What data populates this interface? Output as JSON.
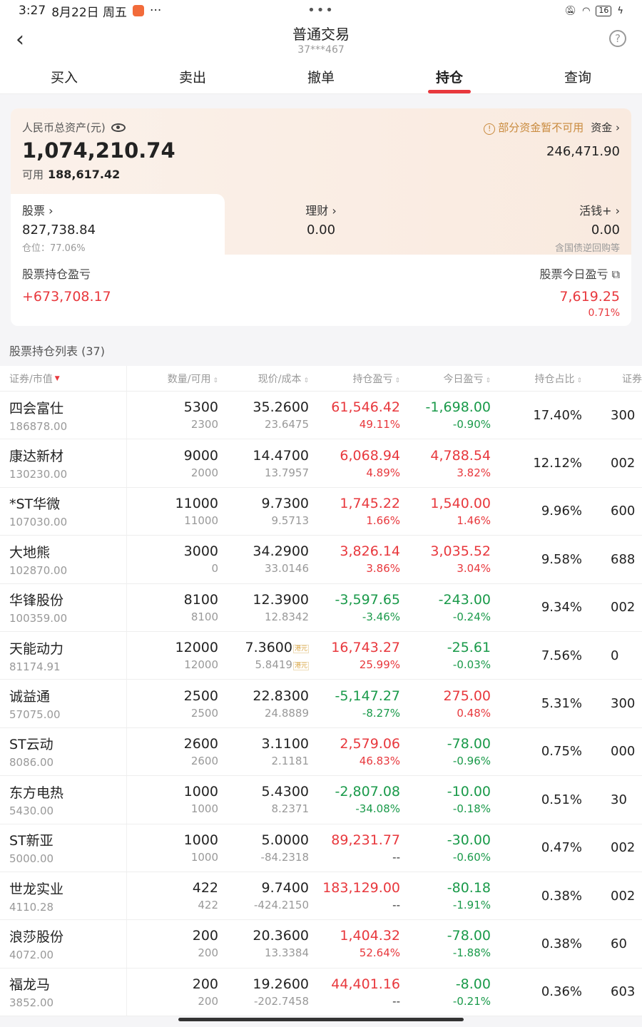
{
  "status": {
    "time": "3:27",
    "date": "8月22日 周五",
    "more": "···",
    "center_dots": "•••",
    "battery": "16"
  },
  "nav": {
    "back": "‹",
    "title": "普通交易",
    "account": "37***467",
    "help": "?"
  },
  "tabs": [
    "买入",
    "卖出",
    "撤单",
    "持仓",
    "查询"
  ],
  "active_tab": "持仓",
  "asset": {
    "label": "人民币总资产(元)",
    "total": "1,074,210.74",
    "available_label": "可用",
    "available": "188,617.42",
    "notice": "部分资金暂不可用",
    "fund_label": "资金 ›",
    "fund_value": "246,471.90",
    "stock_label": "股票 ›",
    "stock_value": "827,738.84",
    "position_label": "仓位：77.06%",
    "lc_label": "理财 ›",
    "lc_value": "0.00",
    "hq_label": "活钱+ ›",
    "hq_value": "0.00",
    "hq_note": "含国债逆回购等",
    "holding_pnl_label": "股票持仓盈亏",
    "holding_pnl": "+673,708.17",
    "today_pnl_label": "股票今日盈亏",
    "today_pnl": "7,619.25",
    "today_pnl_pct": "0.71%"
  },
  "list_title": "股票持仓列表 (37)",
  "headers": [
    "证券/市值",
    "数量/可用",
    "现价/成本",
    "持仓盈亏",
    "今日盈亏",
    "持仓占比",
    "证券"
  ],
  "rows": [
    {
      "name": "四会富仕",
      "mv": "186878.00",
      "qty": "5300",
      "avail": "2300",
      "price": "35.2600",
      "cost": "23.6475",
      "pnl": "61,546.42",
      "pnl_pct": "49.11%",
      "pnl_c": "red",
      "today": "-1,698.00",
      "today_pct": "-0.90%",
      "today_c": "green",
      "ratio": "17.40%",
      "code": "300"
    },
    {
      "name": "康达新材",
      "mv": "130230.00",
      "qty": "9000",
      "avail": "2000",
      "price": "14.4700",
      "cost": "13.7957",
      "pnl": "6,068.94",
      "pnl_pct": "4.89%",
      "pnl_c": "red",
      "today": "4,788.54",
      "today_pct": "3.82%",
      "today_c": "red",
      "ratio": "12.12%",
      "code": "002"
    },
    {
      "name": "*ST华微",
      "mv": "107030.00",
      "qty": "11000",
      "avail": "11000",
      "price": "9.7300",
      "cost": "9.5713",
      "pnl": "1,745.22",
      "pnl_pct": "1.66%",
      "pnl_c": "red",
      "today": "1,540.00",
      "today_pct": "1.46%",
      "today_c": "red",
      "ratio": "9.96%",
      "code": "600"
    },
    {
      "name": "大地熊",
      "mv": "102870.00",
      "qty": "3000",
      "avail": "0",
      "price": "34.2900",
      "cost": "33.0146",
      "pnl": "3,826.14",
      "pnl_pct": "3.86%",
      "pnl_c": "red",
      "today": "3,035.52",
      "today_pct": "3.04%",
      "today_c": "red",
      "ratio": "9.58%",
      "code": "688"
    },
    {
      "name": "华锋股份",
      "mv": "100359.00",
      "qty": "8100",
      "avail": "8100",
      "price": "12.3900",
      "cost": "12.8342",
      "pnl": "-3,597.65",
      "pnl_pct": "-3.46%",
      "pnl_c": "green",
      "today": "-243.00",
      "today_pct": "-0.24%",
      "today_c": "green",
      "ratio": "9.34%",
      "code": "002"
    },
    {
      "name": "天能动力",
      "mv": "81174.91",
      "qty": "12000",
      "avail": "12000",
      "price": "7.3600",
      "cost": "5.8419",
      "hk": "港元",
      "pnl": "16,743.27",
      "pnl_pct": "25.99%",
      "pnl_c": "red",
      "today": "-25.61",
      "today_pct": "-0.03%",
      "today_c": "green",
      "ratio": "7.56%",
      "code": "0"
    },
    {
      "name": "诚益通",
      "mv": "57075.00",
      "qty": "2500",
      "avail": "2500",
      "price": "22.8300",
      "cost": "24.8889",
      "pnl": "-5,147.27",
      "pnl_pct": "-8.27%",
      "pnl_c": "green",
      "today": "275.00",
      "today_pct": "0.48%",
      "today_c": "red",
      "ratio": "5.31%",
      "code": "300"
    },
    {
      "name": "ST云动",
      "mv": "8086.00",
      "qty": "2600",
      "avail": "2600",
      "price": "3.1100",
      "cost": "2.1181",
      "pnl": "2,579.06",
      "pnl_pct": "46.83%",
      "pnl_c": "red",
      "today": "-78.00",
      "today_pct": "-0.96%",
      "today_c": "green",
      "ratio": "0.75%",
      "code": "000"
    },
    {
      "name": "东方电热",
      "mv": "5430.00",
      "qty": "1000",
      "avail": "1000",
      "price": "5.4300",
      "cost": "8.2371",
      "pnl": "-2,807.08",
      "pnl_pct": "-34.08%",
      "pnl_c": "green",
      "today": "-10.00",
      "today_pct": "-0.18%",
      "today_c": "green",
      "ratio": "0.51%",
      "code": "30"
    },
    {
      "name": "ST新亚",
      "mv": "5000.00",
      "qty": "1000",
      "avail": "1000",
      "price": "5.0000",
      "cost": "-84.2318",
      "pnl": "89,231.77",
      "pnl_pct": "--",
      "pnl_c": "red",
      "today": "-30.00",
      "today_pct": "-0.60%",
      "today_c": "green",
      "ratio": "0.47%",
      "code": "002"
    },
    {
      "name": "世龙实业",
      "mv": "4110.28",
      "qty": "422",
      "avail": "422",
      "price": "9.7400",
      "cost": "-424.2150",
      "pnl": "183,129.00",
      "pnl_pct": "--",
      "pnl_c": "red",
      "today": "-80.18",
      "today_pct": "-1.91%",
      "today_c": "green",
      "ratio": "0.38%",
      "code": "002"
    },
    {
      "name": "浪莎股份",
      "mv": "4072.00",
      "qty": "200",
      "avail": "200",
      "price": "20.3600",
      "cost": "13.3384",
      "pnl": "1,404.32",
      "pnl_pct": "52.64%",
      "pnl_c": "red",
      "today": "-78.00",
      "today_pct": "-1.88%",
      "today_c": "green",
      "ratio": "0.38%",
      "code": "60"
    },
    {
      "name": "福龙马",
      "mv": "3852.00",
      "qty": "200",
      "avail": "200",
      "price": "19.2600",
      "cost": "-202.7458",
      "pnl": "44,401.16",
      "pnl_pct": "--",
      "pnl_c": "red",
      "today": "-8.00",
      "today_pct": "-0.21%",
      "today_c": "green",
      "ratio": "0.36%",
      "code": "603"
    }
  ]
}
